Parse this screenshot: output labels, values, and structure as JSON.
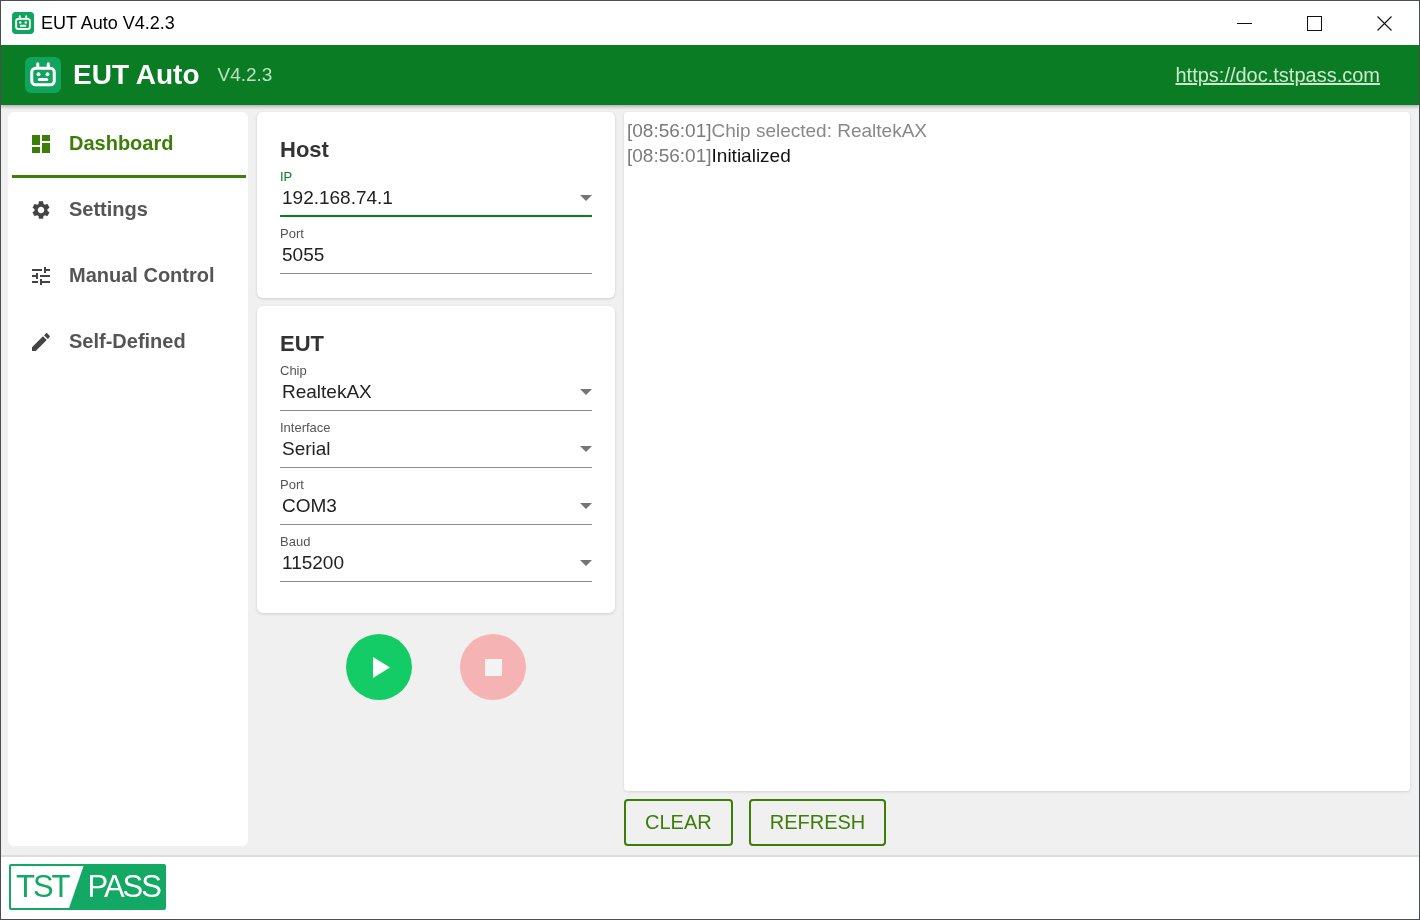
{
  "window": {
    "title": "EUT Auto V4.2.3"
  },
  "header": {
    "app_name": "EUT Auto",
    "version": "V4.2.3",
    "link": "https://doc.tstpass.com"
  },
  "sidebar": {
    "items": [
      {
        "label": "Dashboard",
        "selected": true
      },
      {
        "label": "Settings",
        "selected": false
      },
      {
        "label": "Manual Control",
        "selected": false
      },
      {
        "label": "Self-Defined",
        "selected": false
      }
    ]
  },
  "panels": [
    {
      "title": "Host",
      "fields": [
        {
          "label": "IP",
          "value": "192.168.74.1",
          "kind": "select",
          "focused": true
        },
        {
          "label": "Port",
          "value": "5055",
          "kind": "text",
          "focused": false
        }
      ]
    },
    {
      "title": "EUT",
      "fields": [
        {
          "label": "Chip",
          "value": "RealtekAX",
          "kind": "select",
          "focused": false
        },
        {
          "label": "Interface",
          "value": "Serial",
          "kind": "select",
          "focused": false
        },
        {
          "label": "Port",
          "value": "COM3",
          "kind": "select",
          "focused": false
        },
        {
          "label": "Baud",
          "value": "115200",
          "kind": "select",
          "focused": false
        }
      ]
    }
  ],
  "run_controls": [
    {
      "kind": "play",
      "disabled": false
    },
    {
      "kind": "stop",
      "disabled": true
    }
  ],
  "log": {
    "lines": [
      {
        "time": "[08:56:01]",
        "message": "Chip selected: RealtekAX",
        "kind": "debug"
      },
      {
        "time": "[08:56:01]",
        "message": "Initialized",
        "kind": "info"
      }
    ]
  },
  "log_buttons": [
    "CLEAR",
    "REFRESH"
  ],
  "footer": {
    "logo": [
      "TST",
      "PASS"
    ]
  }
}
